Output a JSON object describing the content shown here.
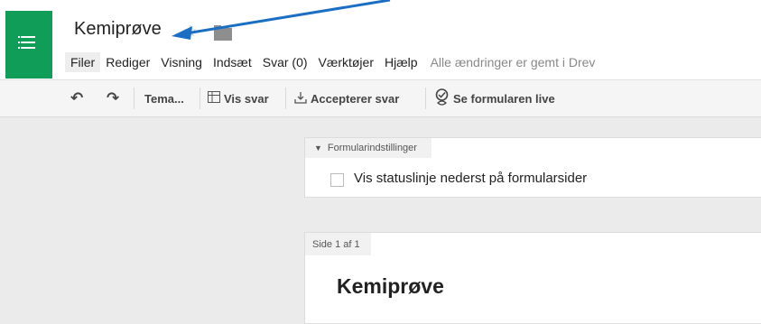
{
  "doc": {
    "title": "Kemiprøve"
  },
  "icons": {
    "app": "list-icon",
    "star": "star-icon",
    "folder": "folder-icon",
    "arrow": "annotation-arrow"
  },
  "colors": {
    "app_green": "#0f9d58",
    "arrow_blue": "#1a6fc4"
  },
  "menu": {
    "items": [
      "Filer",
      "Rediger",
      "Visning",
      "Indsæt",
      "Svar (0)",
      "Værktøjer",
      "Hjælp"
    ],
    "save_status": "Alle ændringer er gemt i Drev"
  },
  "toolbar": {
    "theme": "Tema...",
    "view_responses": "Vis svar",
    "accepting": "Accepterer svar",
    "live_form": "Se formularen live"
  },
  "settings": {
    "tab_label": "Formularindstillinger",
    "progress_bar_label": "Vis statuslinje nederst på formularsider",
    "progress_bar_checked": false
  },
  "page": {
    "tab_label": "Side 1 af 1",
    "form_title": "Kemiprøve"
  }
}
